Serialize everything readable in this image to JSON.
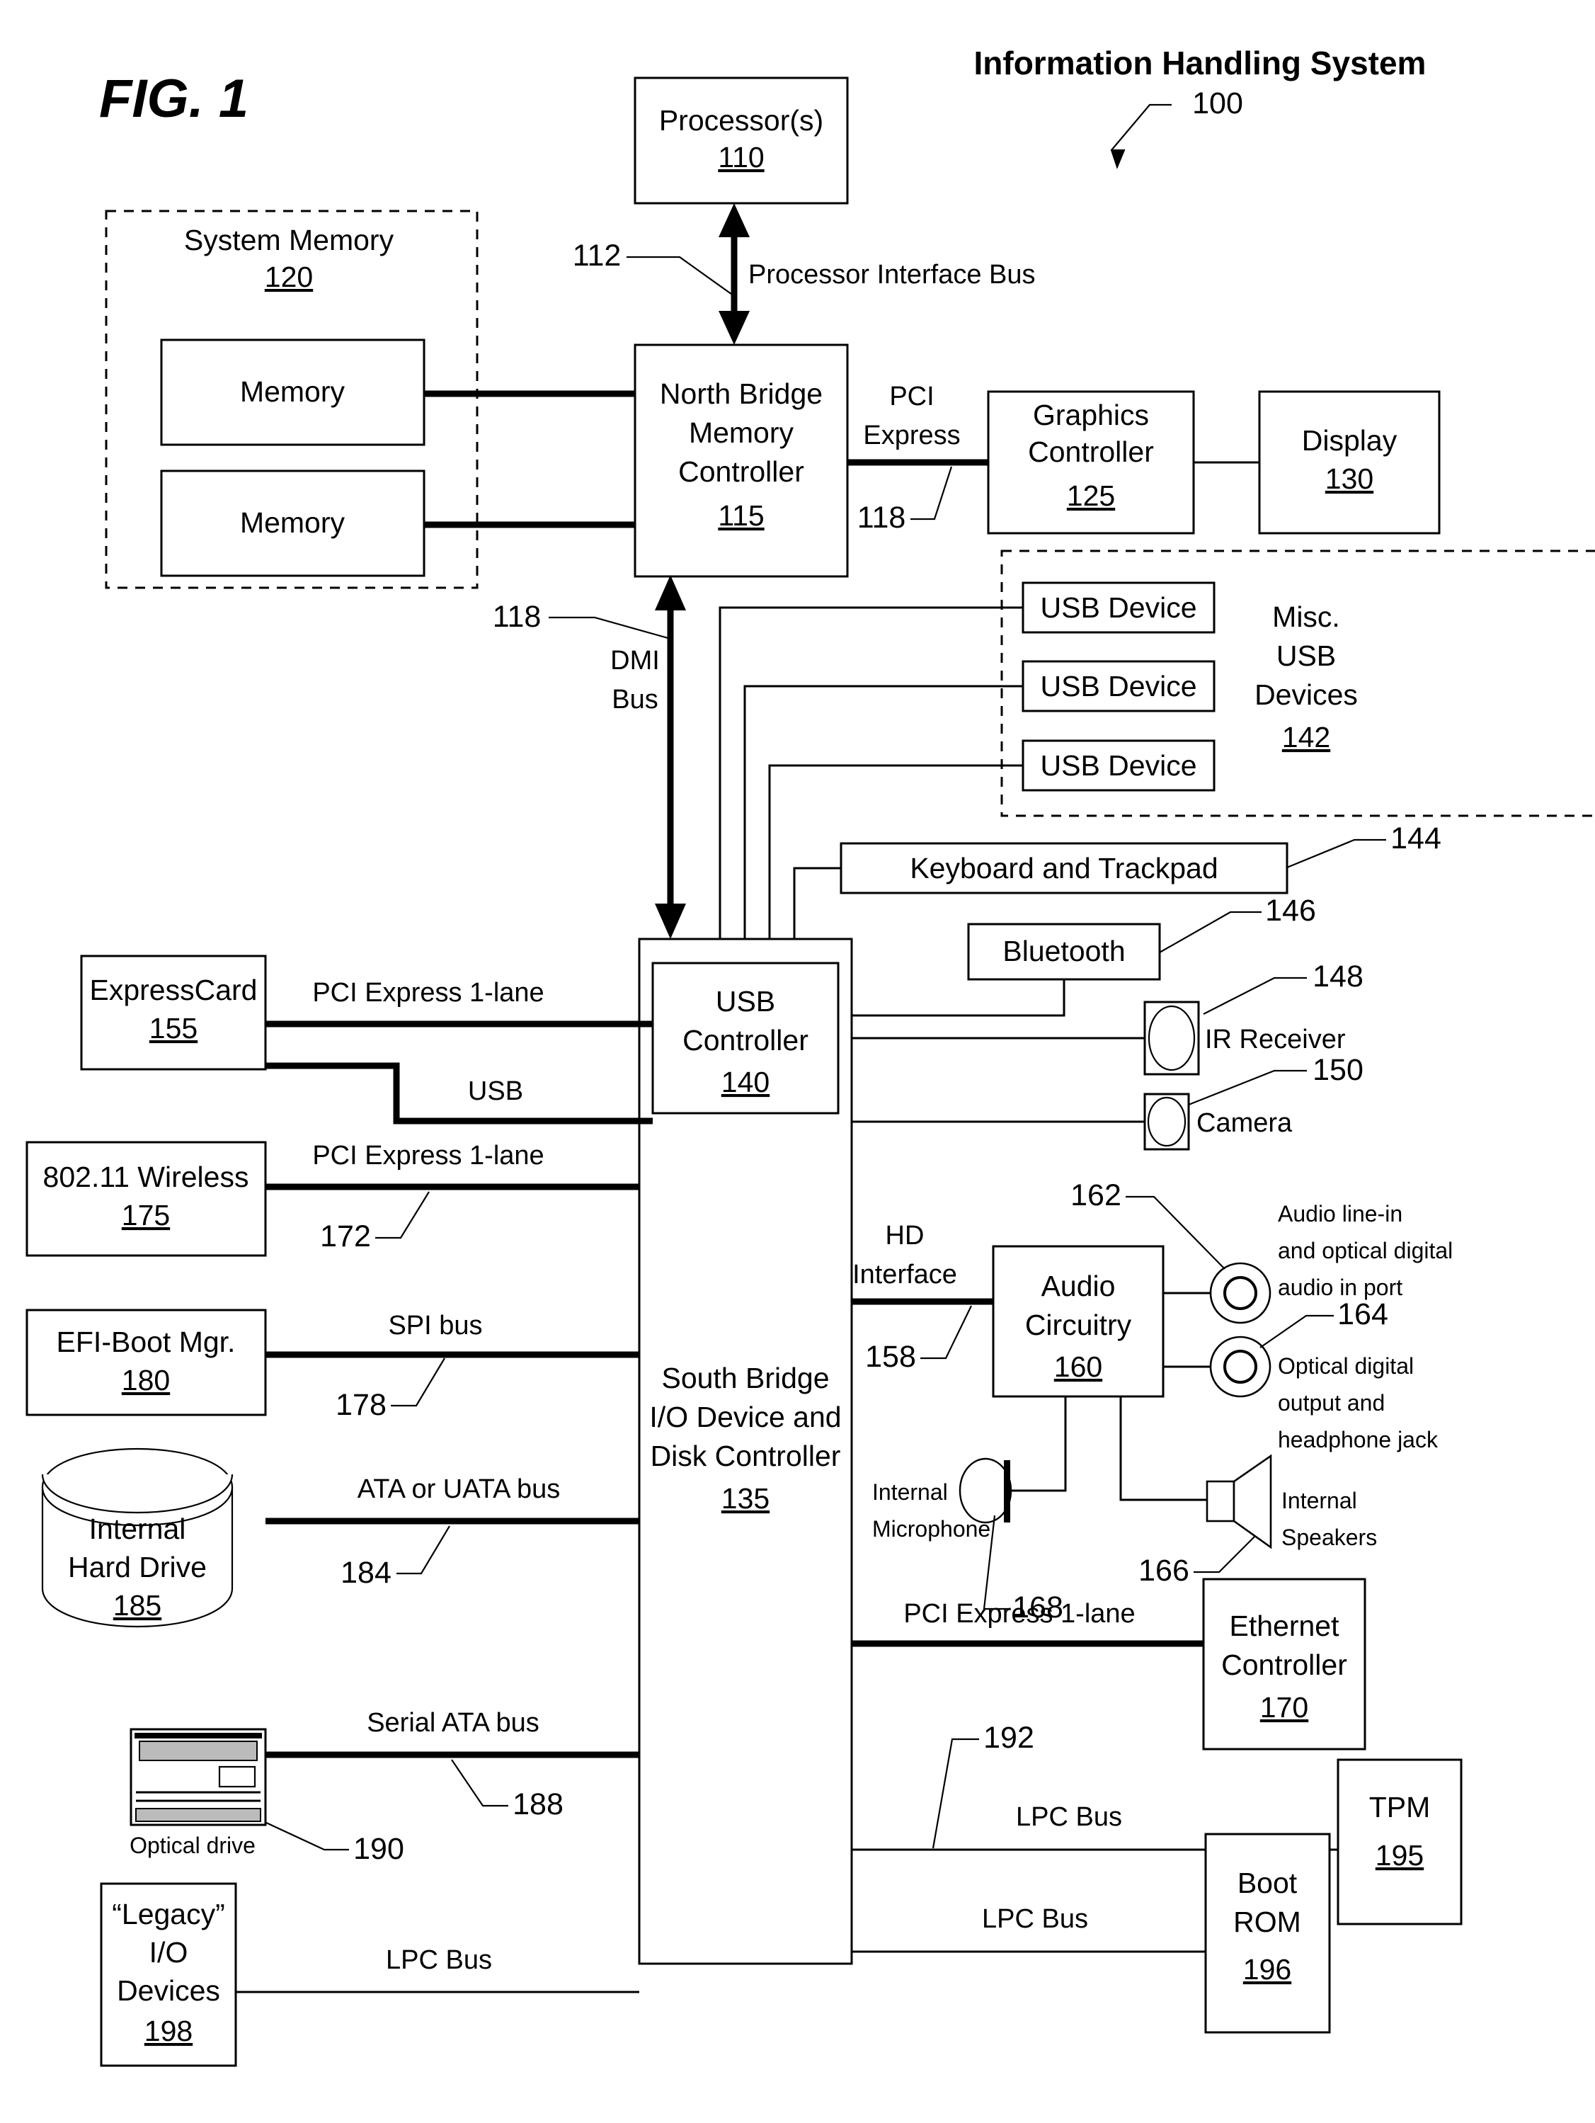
{
  "figure": {
    "label": "FIG. 1",
    "system_title": "Information Handling System",
    "system_ref": "100"
  },
  "blocks": {
    "processors": {
      "line1": "Processor(s)",
      "ref": "110"
    },
    "system_memory": {
      "line1": "System Memory",
      "ref": "120"
    },
    "memory_a": {
      "line1": "Memory"
    },
    "memory_b": {
      "line1": "Memory"
    },
    "north_bridge": {
      "line1": "North Bridge",
      "line2": "Memory",
      "line3": "Controller",
      "ref": "115"
    },
    "graphics": {
      "line1": "Graphics",
      "line2": "Controller",
      "ref": "125"
    },
    "display": {
      "line1": "Display",
      "ref": "130"
    },
    "usb_device_1": {
      "line1": "USB Device"
    },
    "usb_device_2": {
      "line1": "USB Device"
    },
    "usb_device_3": {
      "line1": "USB Device"
    },
    "misc_usb": {
      "line1": "Misc.",
      "line2": "USB",
      "line3": "Devices",
      "ref": "142"
    },
    "keyboard": {
      "line1": "Keyboard and Trackpad"
    },
    "bluetooth": {
      "line1": "Bluetooth"
    },
    "ir_receiver": {
      "line1": "IR Receiver"
    },
    "camera": {
      "line1": "Camera"
    },
    "usb_controller": {
      "line1": "USB",
      "line2": "Controller",
      "ref": "140"
    },
    "south_bridge": {
      "line1": "South Bridge",
      "line2": "I/O Device and",
      "line3": "Disk Controller",
      "ref": "135"
    },
    "expresscard": {
      "line1": "ExpressCard",
      "ref": "155"
    },
    "wireless": {
      "line1": "802.11 Wireless",
      "ref": "175"
    },
    "efi_boot": {
      "line1": "EFI-Boot Mgr.",
      "ref": "180"
    },
    "hard_drive": {
      "line1": "Internal",
      "line2": "Hard Drive",
      "ref": "185"
    },
    "optical_drive": {
      "line1": "Optical drive"
    },
    "legacy_io": {
      "line1": "“Legacy”",
      "line2": "I/O",
      "line3": "Devices",
      "ref": "198"
    },
    "audio_circuitry": {
      "line1": "Audio",
      "line2": "Circuitry",
      "ref": "160"
    },
    "audio_line_in": {
      "line1": "Audio line-in",
      "line2": "and optical digital",
      "line3": "audio in port"
    },
    "optical_out": {
      "line1": "Optical digital",
      "line2": "output and",
      "line3": "headphone jack"
    },
    "internal_mic": {
      "line1": "Internal",
      "line2": "Microphone"
    },
    "internal_spk": {
      "line1": "Internal",
      "line2": "Speakers"
    },
    "ethernet": {
      "line1": "Ethernet",
      "line2": "Controller",
      "ref": "170"
    },
    "tpm": {
      "line1": "TPM",
      "ref": "195"
    },
    "boot_rom": {
      "line1": "Boot",
      "line2": "ROM",
      "ref": "196"
    }
  },
  "bus_labels": {
    "processor_interface": "Processor Interface Bus",
    "pci_express_1": "PCI",
    "pci_express_2": "Express",
    "dmi_1": "DMI",
    "dmi_2": "Bus",
    "pcie_1lane_expresscard": "PCI Express 1-lane",
    "usb": "USB",
    "pcie_1lane_wireless": "PCI Express 1-lane",
    "spi_bus": "SPI bus",
    "ata_uata": "ATA or UATA bus",
    "serial_ata": "Serial ATA bus",
    "lpc_legacy": "LPC Bus",
    "hd_1": "HD",
    "hd_2": "Interface",
    "pcie_1lane_ethernet": "PCI Express 1-lane",
    "lpc_tpm": "LPC Bus",
    "lpc_bootrom": "LPC Bus"
  },
  "ref_numbers": {
    "n112": "112",
    "n118_pcie": "118",
    "n118_dmi": "118",
    "n144": "144",
    "n146": "146",
    "n148": "148",
    "n150": "150",
    "n172": "172",
    "n178": "178",
    "n184": "184",
    "n188": "188",
    "n190": "190",
    "n192": "192",
    "n158": "158",
    "n162": "162",
    "n164": "164",
    "n166": "166",
    "n168": "168"
  },
  "colors": {
    "stroke": "#000000",
    "fill": "#ffffff"
  }
}
